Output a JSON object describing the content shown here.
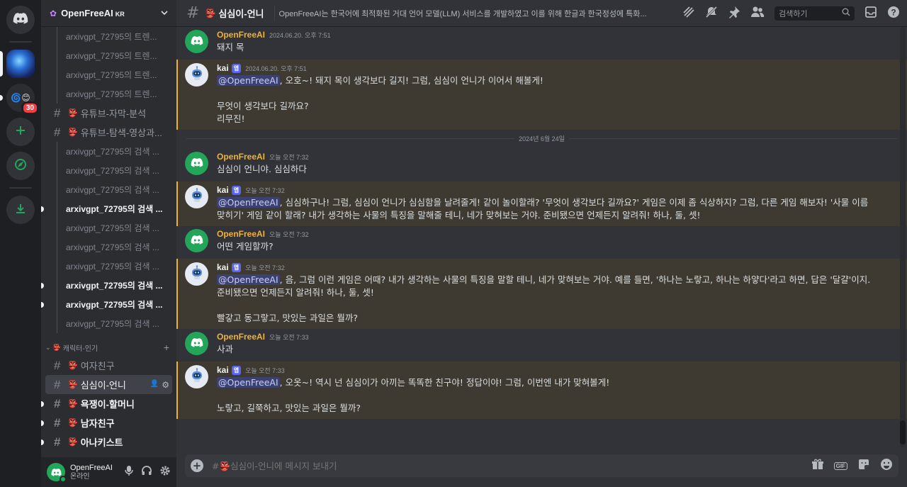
{
  "server": {
    "name": "OpenFreeAI",
    "region_tag": "KR"
  },
  "rail": {
    "unread_badge": "30"
  },
  "sidebar": {
    "threads_top": [
      {
        "label": "arxivgpt_72795의 트렌...",
        "bold": false
      },
      {
        "label": "arxivgpt_72795의 트렌...",
        "bold": false
      },
      {
        "label": "arxivgpt_72795의 트렌...",
        "bold": false
      },
      {
        "label": "arxivgpt_72795의 트렌...",
        "bold": false
      }
    ],
    "channel_youtube_subtitle": "유튜브-자막-분석",
    "channel_youtube_search": "유튜브-탐색-영상과...",
    "threads_search": [
      {
        "label": "arxivgpt_72795의 검색 ...",
        "bold": false
      },
      {
        "label": "arxivgpt_72795의 검색 ...",
        "bold": false
      },
      {
        "label": "arxivgpt_72795의 검색 ...",
        "bold": false
      },
      {
        "label": "arxivgpt_72795의 검색 ...",
        "bold": true
      },
      {
        "label": "arxivgpt_72795의 검색 ...",
        "bold": false
      },
      {
        "label": "arxivgpt_72795의 검색 ...",
        "bold": false
      },
      {
        "label": "arxivgpt_72795의 검색 ...",
        "bold": false
      },
      {
        "label": "arxivgpt_72795의 검색 ...",
        "bold": true
      },
      {
        "label": "arxivgpt_72795의 검색 ...",
        "bold": true
      },
      {
        "label": "arxivgpt_72795의 검색 ...",
        "bold": false
      }
    ],
    "category": "캐릭터-인기",
    "char_channels": [
      {
        "label": "여자친구",
        "state": "normal"
      },
      {
        "label": "심심이-언니",
        "state": "active"
      },
      {
        "label": "욕쟁이-할머니",
        "state": "unread"
      },
      {
        "label": "남자친구",
        "state": "unread"
      },
      {
        "label": "아나키스트",
        "state": "unread"
      }
    ]
  },
  "user": {
    "name": "OpenFreeAI",
    "status": "온라인"
  },
  "topbar": {
    "channel": "심심이-언니",
    "topic": "OpenFreeAI는 한국어에 최적화된 거대 언어 모델(LLM) 서비스를 개발하였고 이를 위해 한글과 한국정성에 특화...",
    "search_placeholder": "검색하기"
  },
  "messages": [
    {
      "author": "OpenFreeAI",
      "kind": "user",
      "time": "2024.06.20. 오후 7:51",
      "mention": "",
      "text": "돼지 목"
    },
    {
      "author": "kai",
      "kind": "bot",
      "app_tag": "앱",
      "time": "2024.06.20. 오후 7:51",
      "mention": "@OpenFreeAI",
      "text": ", 오호~! 돼지 목이 생각보다 길지! 그럼, 심심이 언니가 이어서 해볼게!\n\n무엇이 생각보다 길까요?\n리무진!"
    },
    {
      "divider": "2024년 6월 24일"
    },
    {
      "author": "OpenFreeAI",
      "kind": "user",
      "time": "오늘 오전 7:32",
      "mention": "",
      "text": "심심이 언니야. 심심하다"
    },
    {
      "author": "kai",
      "kind": "bot",
      "app_tag": "앱",
      "time": "오늘 오전 7:32",
      "mention": "@OpenFreeAI",
      "text": ", 심심하구나! 그럼, 심심이 언니가 심심함을 날려줄게! 같이 놀이할래? '무엇이 생각보다 길까요?' 게임은 이제 좀 식상하지? 그럼, 다른 게임 해보자! '사물 이름 맞히기' 게임 같이 할래? 내가 생각하는 사물의 특징을 말해줄 테니, 네가 맞혀보는 거야. 준비됐으면 언제든지 알려줘! 하나, 둘, 셋!"
    },
    {
      "author": "OpenFreeAI",
      "kind": "user",
      "time": "오늘 오전 7:32",
      "mention": "",
      "text": "어떤 게임할까?"
    },
    {
      "author": "kai",
      "kind": "bot",
      "app_tag": "앱",
      "time": "오늘 오전 7:32",
      "mention": "@OpenFreeAI",
      "text": ", 음, 그럼 이런 게임은 어때? 내가 생각하는 사물의 특징을 말할 테니, 네가 맞혀보는 거야. 예를 들면, '하나는 노랗고, 하나는 하얗다'라고 하면, 답은 '달걀'이지. 준비됐으면 언제든지 알려줘! 하나, 둘, 셋!\n\n빨갛고 동그랗고, 맛있는 과일은 뭘까?"
    },
    {
      "author": "OpenFreeAI",
      "kind": "user",
      "time": "오늘 오전 7:33",
      "mention": "",
      "text": "사과"
    },
    {
      "author": "kai",
      "kind": "bot",
      "app_tag": "앱",
      "time": "오늘 오전 7:33",
      "mention": "@OpenFreeAI",
      "text": ", 오옷~! 역시 넌 심심이가 아끼는 똑똑한 친구야! 정답이야! 그럼, 이번엔 내가 맞혀볼게!\n\n노랗고, 길쭉하고, 맛있는 과일은 뭘까?"
    }
  ],
  "composer": {
    "placeholder": "#👺심심이-언니에 메시지 보내기"
  },
  "colors": {
    "accent_user": "#f0b232",
    "mention_bg": "#3e3a31",
    "online": "#23a55a",
    "blurple": "#5865f2"
  },
  "icons": [
    "discord-logo-icon",
    "add-server-icon",
    "explore-icon",
    "download-icon",
    "threads-icon",
    "mute-icon",
    "pin-icon",
    "members-icon",
    "search-icon",
    "inbox-icon",
    "help-icon",
    "gift-icon",
    "gif-icon",
    "sticker-icon",
    "emoji-icon",
    "mic-icon",
    "headphones-icon",
    "settings-icon"
  ]
}
